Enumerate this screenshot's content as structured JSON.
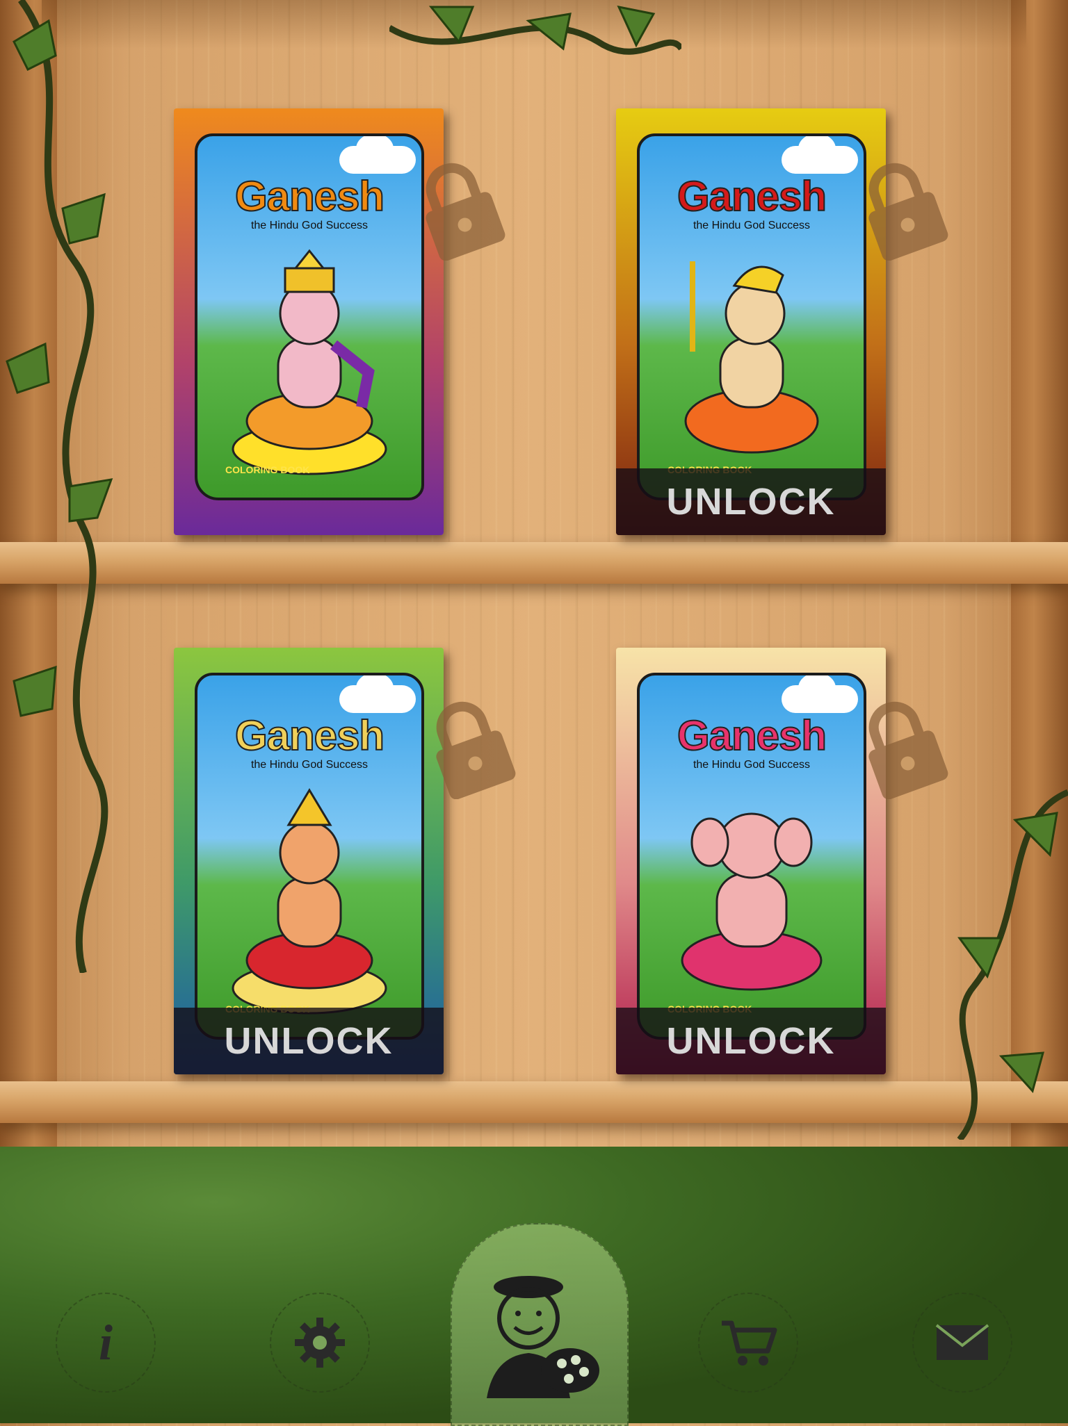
{
  "books": [
    {
      "title": "Ganesh",
      "subtitle": "the Hindu God Success",
      "badge": "COLORING BOOK",
      "locked": false,
      "title_color": "#f08a12",
      "cover_color": "#ef8a1d",
      "cover_color_bottom": "#6a2a9a"
    },
    {
      "title": "Ganesh",
      "subtitle": "the Hindu God Success",
      "badge": "COLORING BOOK",
      "locked": true,
      "action": "UNLOCK",
      "title_color": "#d41a1a",
      "cover_color": "#e6cc12",
      "cover_color_bottom": "#7a2010"
    },
    {
      "title": "Ganesh",
      "subtitle": "the Hindu God Success",
      "badge": "COLORING BOOK",
      "locked": true,
      "action": "UNLOCK",
      "title_color": "#f0d05a",
      "cover_color": "#8cc63f",
      "cover_color_bottom": "#1c5aa8"
    },
    {
      "title": "Ganesh",
      "subtitle": "the Hindu God Success",
      "badge": "COLORING BOOK",
      "locked": true,
      "action": "UNLOCK",
      "title_color": "#e8336b",
      "cover_color": "#f7e3a8",
      "cover_color_bottom": "#b01a4a"
    }
  ],
  "toolbar": {
    "info_icon": "i",
    "items": [
      "info-icon",
      "gear-icon",
      "artist-icon",
      "cart-icon",
      "mail-icon"
    ],
    "active": "artist-icon"
  }
}
